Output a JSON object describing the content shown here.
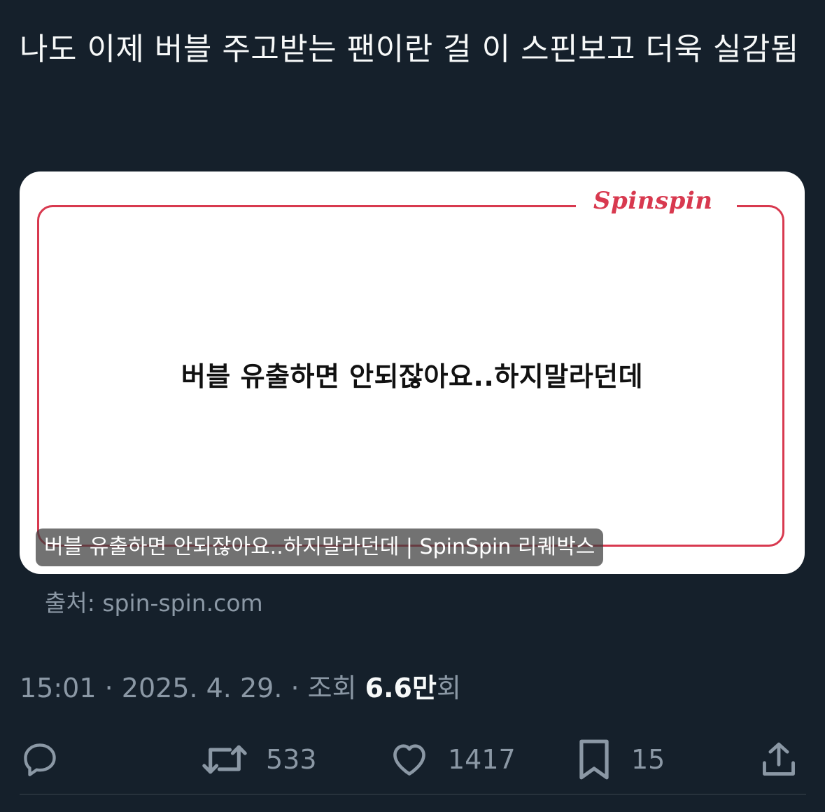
{
  "tweet": {
    "text": "나도 이제 버블 주고받는 팬이란 걸 이 스핀보고 더욱 실감됨"
  },
  "card": {
    "logo": "Spinspin",
    "quote": "버블 유출하면 안되잖아요..하지말라던데",
    "overlay_title": "버블 유출하면 안되잖아요..하지말라던데 | SpinSpin 리퀘박스",
    "source": "출처: spin-spin.com"
  },
  "meta": {
    "time": "15:01",
    "separator": " · ",
    "date": "2025. 4. 29.",
    "views_label": "조회",
    "views_count": "6.6만",
    "views_suffix": "회"
  },
  "actions": {
    "reply": {
      "icon": "reply-icon",
      "count": ""
    },
    "retweet": {
      "icon": "retweet-icon",
      "count": "533"
    },
    "like": {
      "icon": "heart-icon",
      "count": "1417"
    },
    "bookmark": {
      "icon": "bookmark-icon",
      "count": "15"
    },
    "share": {
      "icon": "share-icon"
    }
  },
  "colors": {
    "background": "#15202b",
    "text": "#f7f9f9",
    "muted": "#8b98a5",
    "brand_red": "#d8394f"
  }
}
